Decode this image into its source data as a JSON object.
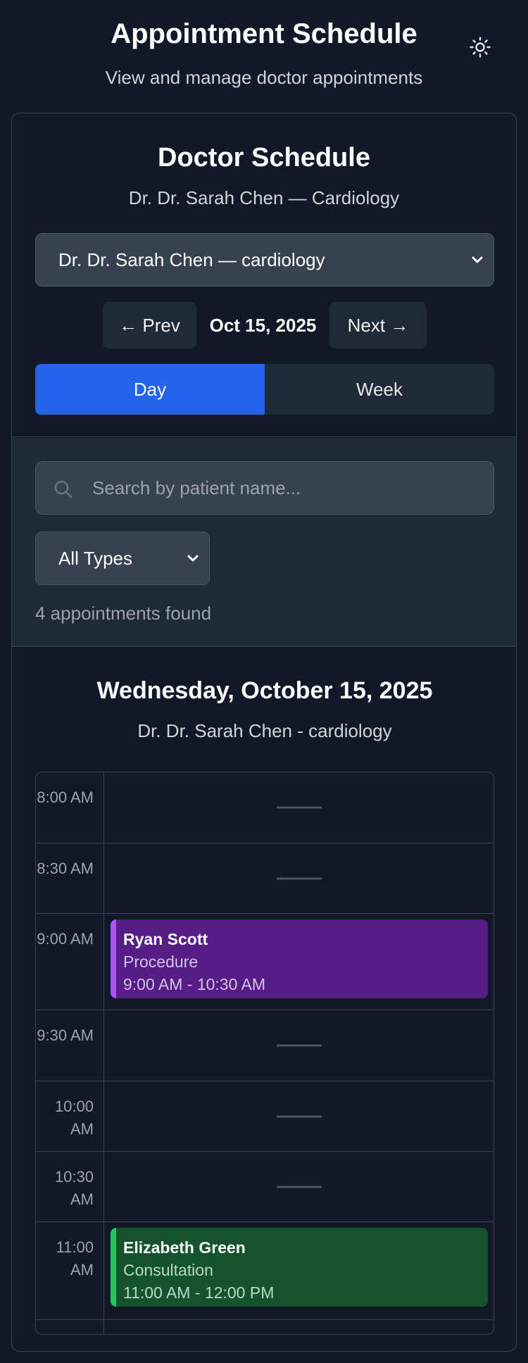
{
  "header": {
    "title": "Appointment Schedule",
    "subtitle": "View and manage doctor appointments",
    "theme_icon": "sun-icon"
  },
  "doctor_card": {
    "title": "Doctor Schedule",
    "subtitle": "Dr. Dr. Sarah Chen — Cardiology",
    "doctor_select_value": "Dr. Dr. Sarah Chen — cardiology",
    "prev_label": "← Prev",
    "current_date": "Oct 15, 2025",
    "next_label": "Next →",
    "views": [
      "Day",
      "Week"
    ],
    "active_view": "Day"
  },
  "filters": {
    "search_placeholder": "Search by patient name...",
    "type_select_value": "All Types",
    "count_text": "4 appointments found"
  },
  "schedule": {
    "day_title": "Wednesday, October 15, 2025",
    "doctor_line": "Dr. Dr. Sarah Chen - cardiology",
    "slots": [
      {
        "time": "8:00 AM"
      },
      {
        "time": "8:30 AM"
      },
      {
        "time": "9:00 AM",
        "appointment": {
          "patient": "Ryan Scott",
          "type": "Procedure",
          "range": "9:00 AM - 10:30 AM",
          "color": "#581c87",
          "accent": "#a855f7"
        }
      },
      {
        "time": "9:30 AM"
      },
      {
        "time": "10:00 AM"
      },
      {
        "time": "10:30 AM"
      },
      {
        "time": "11:00 AM",
        "appointment": {
          "patient": "Elizabeth Green",
          "type": "Consultation",
          "range": "11:00 AM - 12:00 PM",
          "color": "#14532d",
          "accent": "#22c55e"
        }
      }
    ]
  }
}
